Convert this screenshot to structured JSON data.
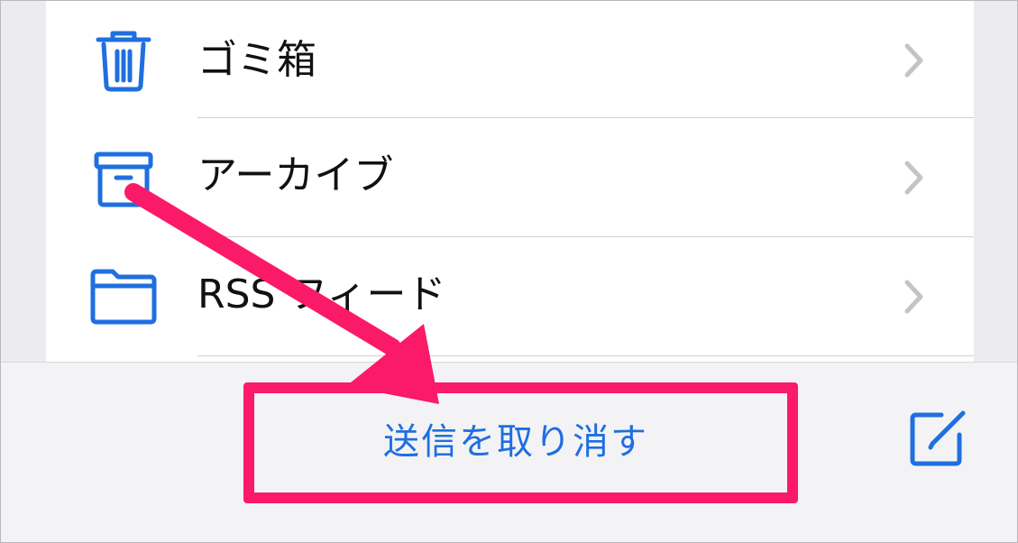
{
  "colors": {
    "accent": "#1f6fe0",
    "annotation": "#fb1a68",
    "chevron": "#c4c4c8",
    "separator": "#cfcfd3"
  },
  "list": {
    "items": [
      {
        "label": "ゴミ箱",
        "icon": "trash-icon"
      },
      {
        "label": "アーカイブ",
        "icon": "archive-box-icon"
      },
      {
        "label": "RSS フィード",
        "icon": "folder-icon"
      }
    ]
  },
  "toolbar": {
    "undo_send_label": "送信を取り消す",
    "compose_icon": "compose-icon"
  },
  "annotation": {
    "arrow_icon": "pointer-arrow-icon",
    "box": "highlight-box"
  }
}
